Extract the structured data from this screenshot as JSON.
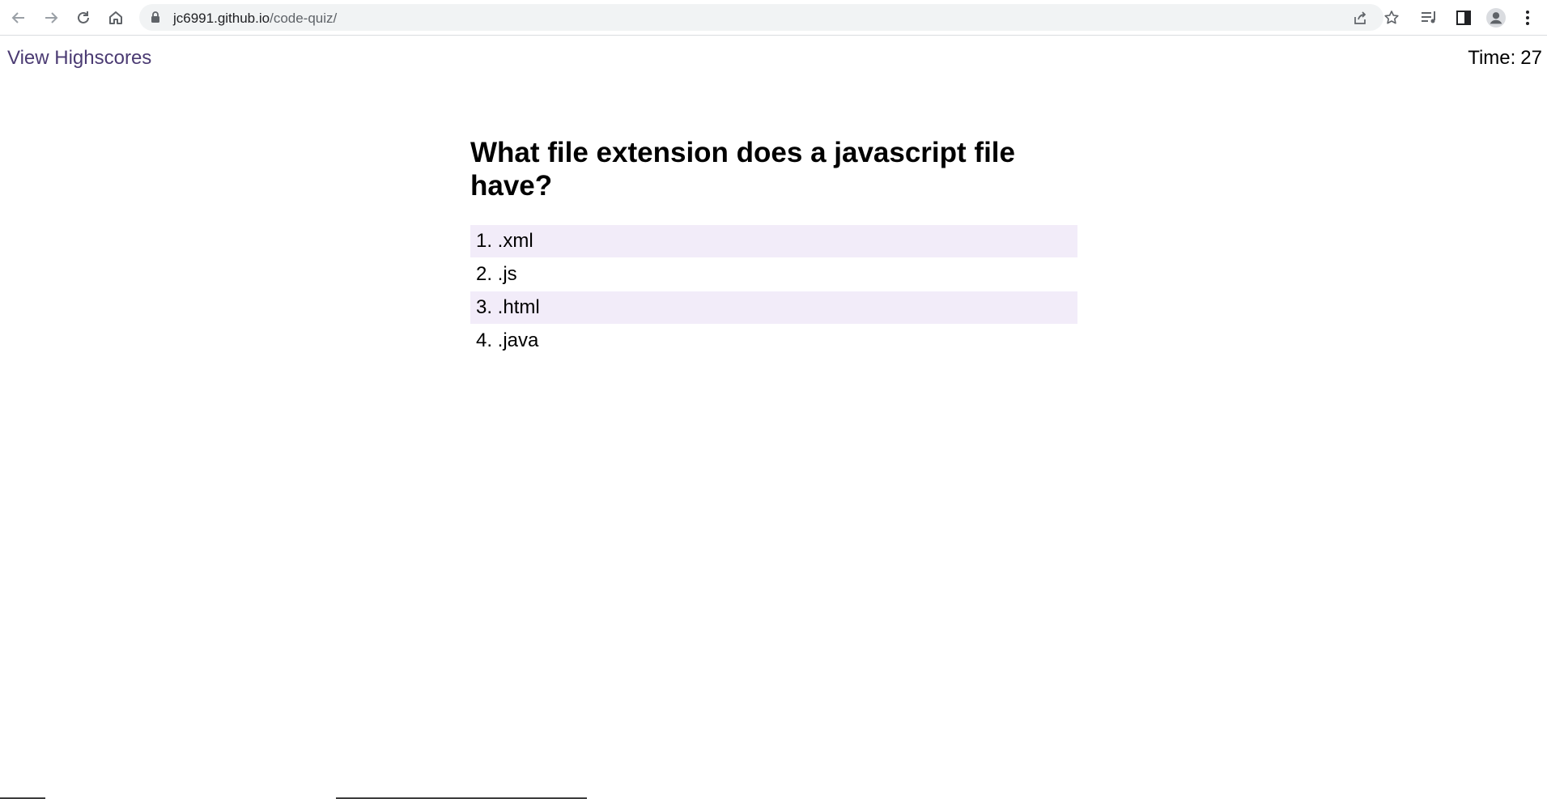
{
  "browser": {
    "url_host": "jc6991.github.io",
    "url_path": "/code-quiz/"
  },
  "header": {
    "highscores_link": "View Highscores",
    "timer_label": "Time:",
    "timer_value": "27"
  },
  "quiz": {
    "question": "What file extension does a javascript file have?",
    "answers": [
      {
        "label": "1. .xml"
      },
      {
        "label": "2. .js"
      },
      {
        "label": "3. .html"
      },
      {
        "label": "4. .java"
      }
    ]
  },
  "colors": {
    "link": "#4b3b73",
    "answer_highlight": "#f2ecf9"
  }
}
